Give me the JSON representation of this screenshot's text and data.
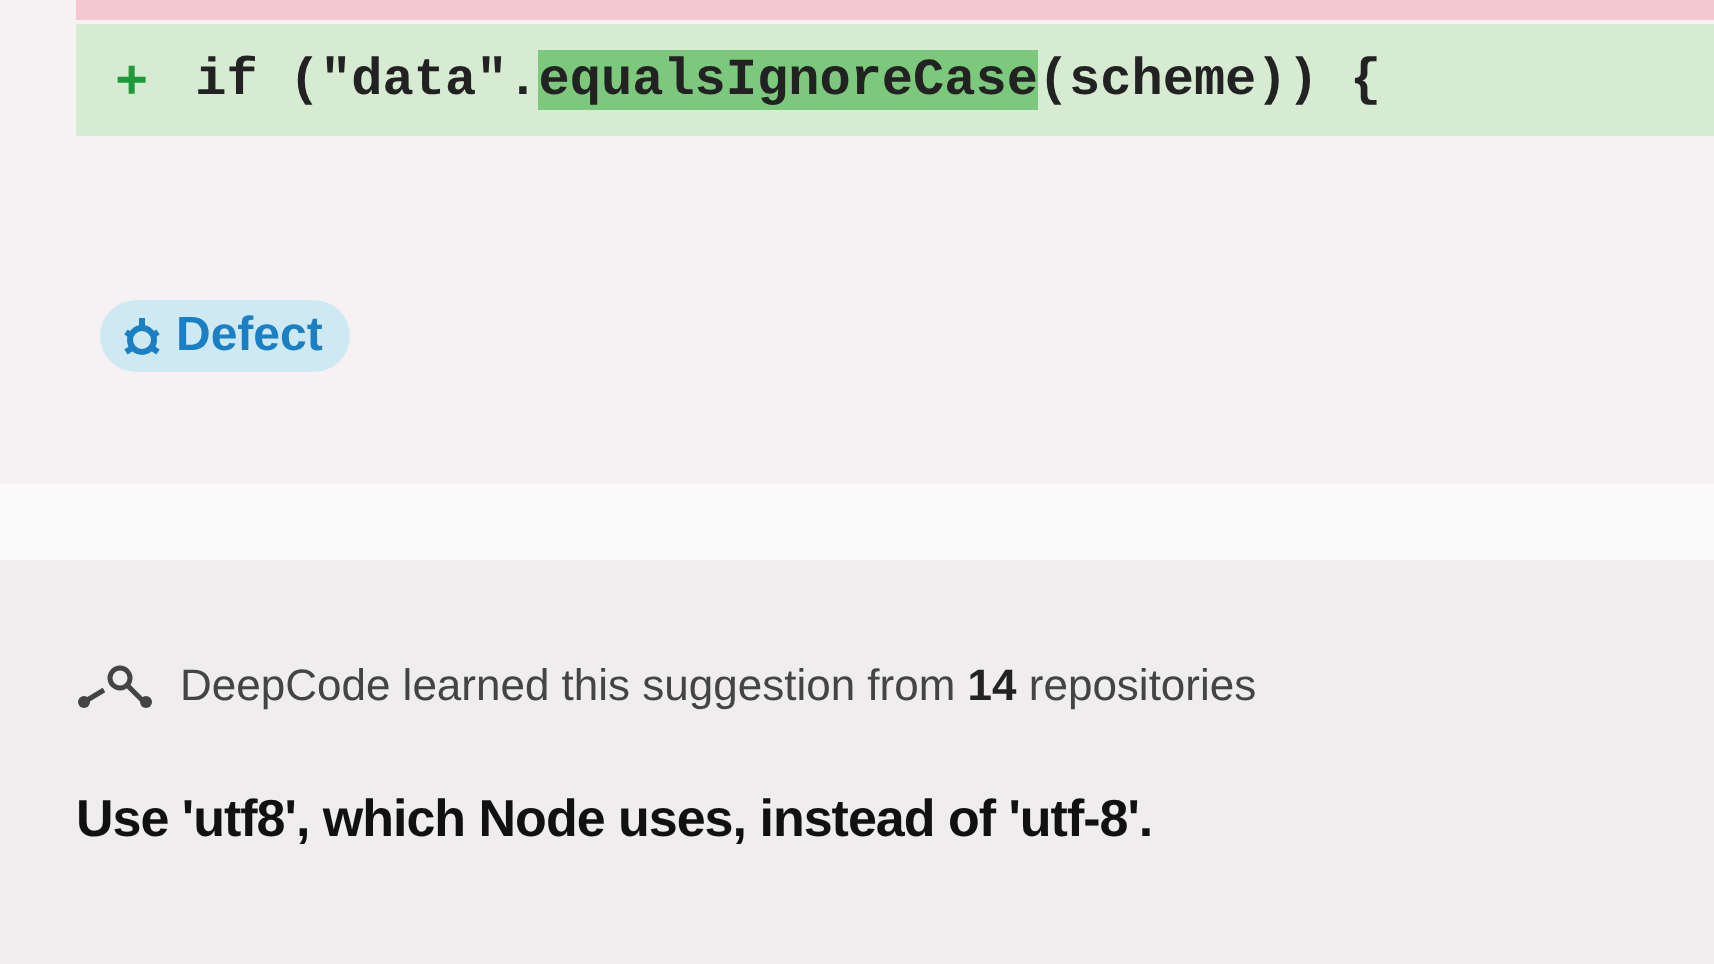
{
  "diff": {
    "lines": [
      {
        "kind": "removed"
      },
      {
        "kind": "added",
        "marker": "+",
        "segments": [
          {
            "text": "if (\"data\".",
            "highlight": false
          },
          {
            "text": "equalsIgnoreCase",
            "highlight": true
          },
          {
            "text": "(scheme)) {",
            "highlight": false
          }
        ]
      }
    ]
  },
  "tag": {
    "label": "Defect"
  },
  "suggestion": {
    "source": "DeepCode learned this suggestion from **14** repositories",
    "message": "Use 'utf8', which Node uses, instead of 'utf-8'."
  }
}
